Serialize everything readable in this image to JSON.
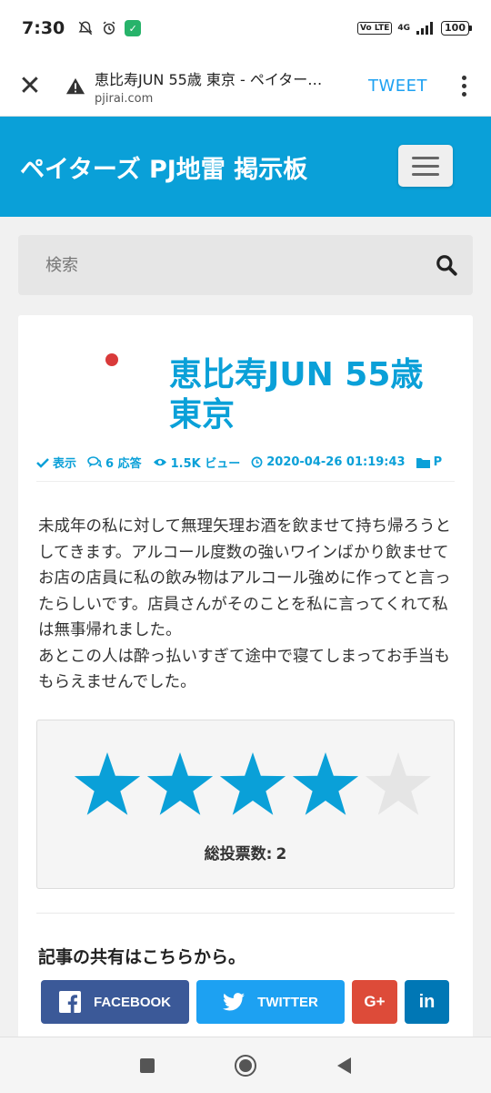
{
  "status_bar": {
    "time": "7:30",
    "lte": "Vo LTE",
    "network": "4G",
    "battery": "100"
  },
  "browser": {
    "page_title": "恵比寿JUN 55歳 東京 - ペイター…",
    "domain": "pjirai.com",
    "tweet_label": "TWEET"
  },
  "site": {
    "title": "ペイターズ PJ地雷 掲示板",
    "accent": "#0aa0d8"
  },
  "search": {
    "placeholder": "検索"
  },
  "article": {
    "title": "恵比寿JUN 55歳 東京",
    "meta": {
      "status": "表示",
      "answers": "6 応答",
      "views": "1.5K ビュー",
      "datetime": "2020-04-26 01:19:43",
      "category": "P"
    },
    "body": "未成年の私に対して無理矢理お酒を飲ませて持ち帰ろうとしてきます。アルコール度数の強いワインばかり飲ませてお店の店員に私の飲み物はアルコール強めに作ってと言ったらしいです。店員さんがそのことを私に言ってくれて私は無事帰れました。\nあとこの人は酔っ払いすぎて途中で寝てしまってお手当ももらえませんでした。"
  },
  "rating": {
    "stars_filled": 4,
    "stars_total": 5,
    "votes_label": "総投票数:",
    "votes_count": "2",
    "filled_color": "#0aa0d8",
    "empty_color": "#e5e5e5"
  },
  "share": {
    "heading": "記事の共有はこちらから。",
    "facebook": "FACEBOOK",
    "twitter": "TWITTER",
    "googleplus": "G+",
    "linkedin": "in"
  }
}
